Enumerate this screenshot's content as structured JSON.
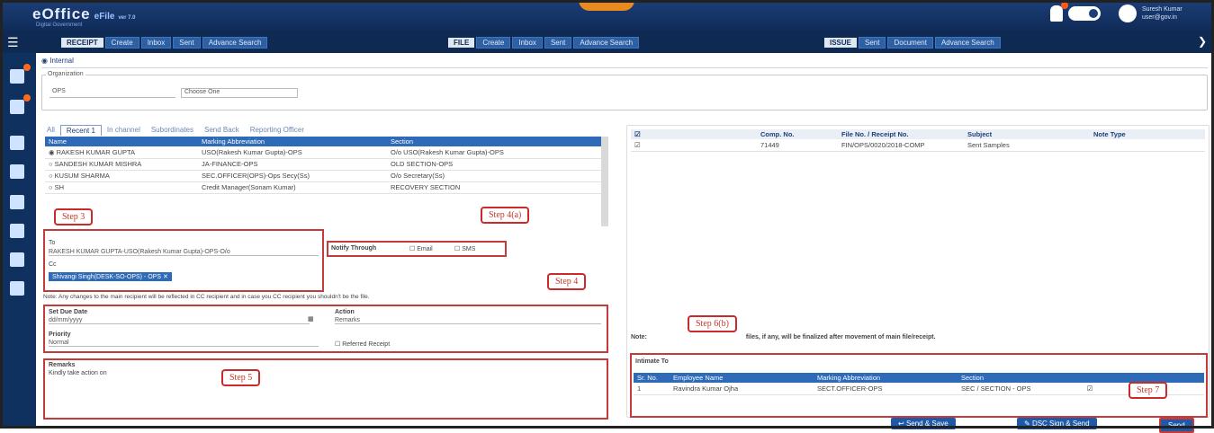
{
  "app": {
    "logo": "eOffice",
    "product": "eFile",
    "version": "ver 7.0",
    "logo_sub": "Digital Government",
    "user_name": "Suresh Kumar",
    "user_role": "user@gov.in"
  },
  "menus": {
    "receipt": {
      "header": "RECEIPT",
      "items": [
        "Create",
        "Inbox",
        "Sent",
        "Advance Search"
      ]
    },
    "file": {
      "header": "FILE",
      "items": [
        "Create",
        "Inbox",
        "Sent",
        "Advance Search"
      ]
    },
    "issue": {
      "header": "ISSUE",
      "items": [
        "Sent",
        "Document",
        "Advance Search"
      ]
    }
  },
  "form": {
    "internal_label": "Internal",
    "org_legend": "Organization",
    "org_value": "OPS",
    "choose_one": "Choose One",
    "tabs": [
      "All",
      "Recent 1",
      "In channel",
      "Subordinates",
      "Send Back",
      "Reporting Officer"
    ],
    "user_table": {
      "columns": [
        "Name",
        "Marking Abbreviation",
        "Section"
      ],
      "rows": [
        [
          "RAKESH KUMAR GUPTA",
          "USO(Rakesh Kumar Gupta)-OPS",
          "O/o USO(Rakesh Kumar Gupta)-OPS"
        ],
        [
          "SANDESH KUMAR MISHRA",
          "JA-FINANCE-OPS",
          "OLD SECTION-OPS"
        ],
        [
          "KUSUM SHARMA",
          "SEC.OFFICER(OPS)-Ops Secy(Ss)",
          "O/o Secretary(Ss)"
        ],
        [
          "SH",
          "Credit Manager(Sonam Kumar)",
          "RECOVERY SECTION"
        ]
      ]
    },
    "to_label": "To",
    "to_value": "RAKESH KUMAR GUPTA-USO(Rakesh Kumar Gupta)-OPS-O/o",
    "cc_label": "Cc",
    "cc_value": "Shivangi Singh(DESK-SO-OPS) - OPS",
    "notify_label": "Notify Through",
    "notify_email": "Email",
    "notify_sms": "SMS",
    "note": "Note: Any changes to the main recipient will be reflected in CC recipient and in case you CC recipient you shouldn't be the file.",
    "due_date_label": "Set Due Date",
    "due_date_value": "dd/mm/yyyy",
    "action_label": "Action",
    "action_value": "Remarks",
    "priority_label": "Priority",
    "priority_value": "Normal",
    "referred_label": "Referred Receipt",
    "remarks_label": "Remarks",
    "remarks_value": "Kindly take action on"
  },
  "right": {
    "columns": [
      "Comp. No.",
      "File No. / Receipt No.",
      "Subject",
      "Note Type"
    ],
    "row": [
      "71449",
      "FIN/OPS/0020/2018-COMP",
      "Sent Samples",
      ""
    ],
    "note_prefix": "Note:",
    "note_suffix": "files, if any, will be finalized after movement of main file/receipt.",
    "intimate_label": "Intimate To",
    "intimate_columns": [
      "Sr. No.",
      "Employee Name",
      "Marking Abbreviation",
      "Section"
    ],
    "intimate_row": [
      "1",
      "Ravindra Kumar Ojha",
      "SECT.OFFICER-OPS",
      "SEC / SECTION - OPS"
    ]
  },
  "buttons": {
    "send_preview": "Send & Save",
    "dsc_send": "DSC Sign & Send",
    "send": "Send"
  },
  "steps": [
    "Step 3",
    "Step 4(a)",
    "Step 4",
    "Step 5",
    "Step 6(b)",
    "Step 7"
  ]
}
